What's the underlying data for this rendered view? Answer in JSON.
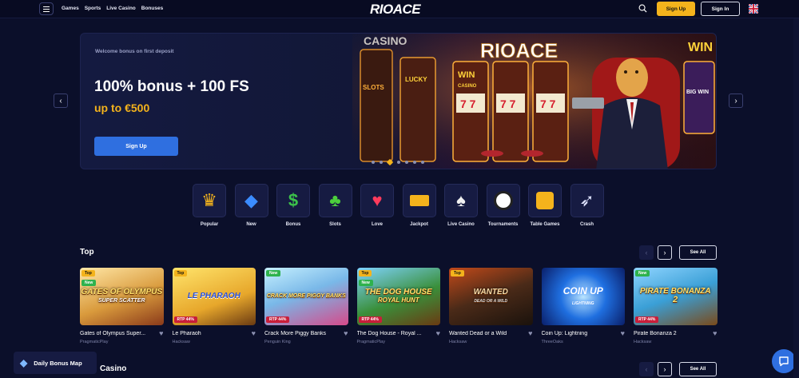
{
  "header": {
    "nav": [
      "Games",
      "Sports",
      "Live Casino",
      "Bonuses"
    ],
    "logo": "RIOACE",
    "signup_label": "Sign Up",
    "signin_label": "Sign In"
  },
  "hero": {
    "kicker": "Welcome bonus on first deposit",
    "title": "100% bonus + 100 FS",
    "subtitle": "up to €500",
    "cta": "Sign Up",
    "art_text": [
      "CASINO",
      "LUCKY",
      "SLOTS",
      "WIN",
      "CASINO",
      "RIOACE",
      "BIG WIN",
      "WIN"
    ],
    "slide_count": 7,
    "active_slide": 3
  },
  "categories": [
    {
      "label": "Popular",
      "icon": "crown-icon"
    },
    {
      "label": "New",
      "icon": "diamond-icon"
    },
    {
      "label": "Bonus",
      "icon": "dollar-coin-icon"
    },
    {
      "label": "Slots",
      "icon": "clover-icon"
    },
    {
      "label": "Love",
      "icon": "hearts-icon"
    },
    {
      "label": "Jackpot",
      "icon": "gold-bars-icon"
    },
    {
      "label": "Live Casino",
      "icon": "cards-icon"
    },
    {
      "label": "Tournaments",
      "icon": "soccer-ball-icon"
    },
    {
      "label": "Table Games",
      "icon": "dice-icon"
    },
    {
      "label": "Crash",
      "icon": "rocket-icon"
    }
  ],
  "top_section": {
    "title": "Top",
    "see_all": "See All",
    "games": [
      {
        "name": "Gates of Olympus Super...",
        "provider": "PragmaticPlay",
        "badges": [
          "Top",
          "New"
        ],
        "rtp": "",
        "art": "GATES OF OLYMPUS",
        "art2": "SUPER SCATTER"
      },
      {
        "name": "Le Pharaoh",
        "provider": "Hacksaw",
        "badges": [
          "Top"
        ],
        "rtp": "RTP 44%",
        "art": "LE PHARAOH",
        "art2": ""
      },
      {
        "name": "Crack More Piggy Banks",
        "provider": "Penguin King",
        "badges": [
          "New"
        ],
        "rtp": "RTP 44%",
        "art": "CRACK MORE PIGGY BANKS",
        "art2": ""
      },
      {
        "name": "The Dog House - Royal ...",
        "provider": "PragmaticPlay",
        "badges": [
          "Top",
          "New"
        ],
        "rtp": "RTP 44%",
        "art": "THE DOG HOUSE",
        "art2": "ROYAL HUNT"
      },
      {
        "name": "Wanted Dead or a Wild",
        "provider": "Hacksaw",
        "badges": [
          "Top"
        ],
        "rtp": "",
        "art": "WANTED",
        "art2": "DEAD OR A WILD"
      },
      {
        "name": "Coin Up: Lightning",
        "provider": "ThreeOaks",
        "badges": [],
        "rtp": "",
        "art": "COIN UP",
        "art2": "LIGHTNING"
      },
      {
        "name": "Pirate Bonanza 2",
        "provider": "Hacksaw",
        "badges": [
          "New"
        ],
        "rtp": "RTP 44%",
        "art": "PIRATE BONANZA",
        "art2": "2"
      }
    ]
  },
  "casino_section": {
    "title": "Casino",
    "see_all": "See All"
  },
  "bonus_map_label": "Daily Bonus Map"
}
